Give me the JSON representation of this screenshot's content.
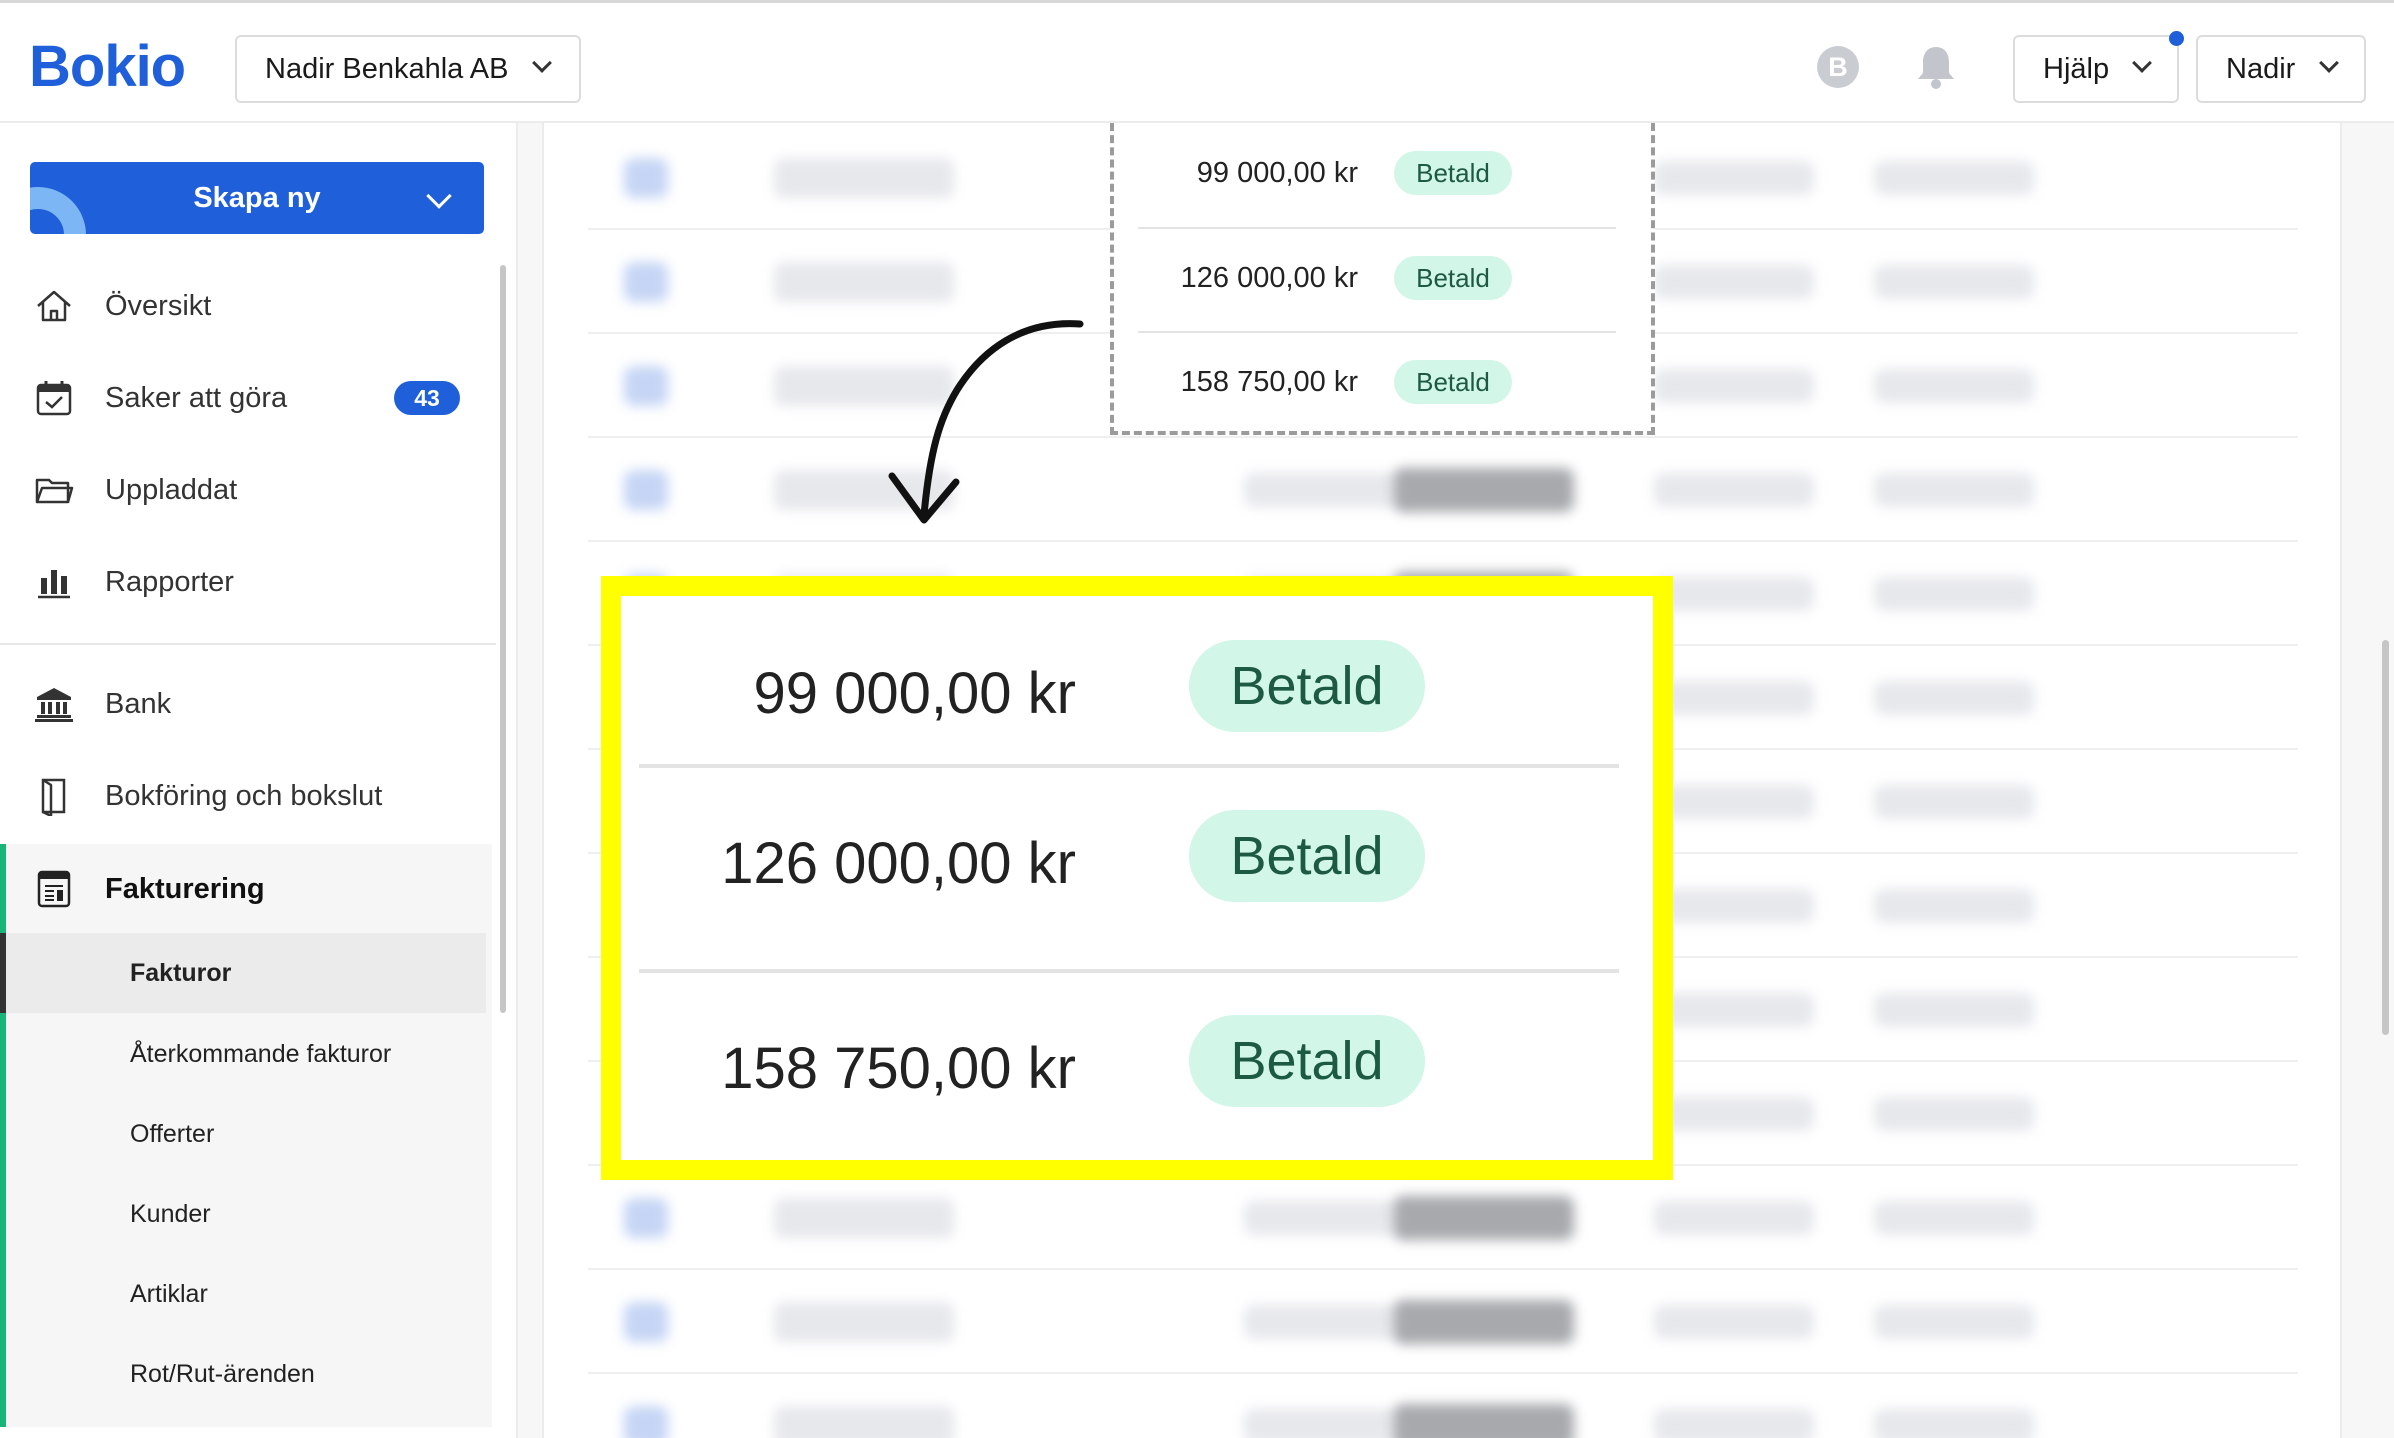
{
  "header": {
    "logo": "Bokio",
    "company": "Nadir Benkahla AB",
    "help_label": "Hjälp",
    "user_label": "Nadir",
    "coin_glyph": "B"
  },
  "sidebar": {
    "create_label": "Skapa ny",
    "items": [
      {
        "label": "Översikt",
        "icon": "home-icon"
      },
      {
        "label": "Saker att göra",
        "icon": "calendar-check-icon",
        "badge": "43"
      },
      {
        "label": "Uppladdat",
        "icon": "folder-icon"
      },
      {
        "label": "Rapporter",
        "icon": "bar-chart-icon"
      },
      {
        "label": "Bank",
        "icon": "bank-icon"
      },
      {
        "label": "Bokföring och bokslut",
        "icon": "book-icon"
      },
      {
        "label": "Fakturering",
        "icon": "invoice-icon"
      }
    ],
    "sub_items": [
      {
        "label": "Fakturor"
      },
      {
        "label": "Återkommande fakturor"
      },
      {
        "label": "Offerter"
      },
      {
        "label": "Kunder"
      },
      {
        "label": "Artiklar"
      },
      {
        "label": "Rot/Rut-ärenden"
      }
    ]
  },
  "invoices": [
    {
      "amount": "99 000,00 kr",
      "status": "Betald"
    },
    {
      "amount": "126 000,00 kr",
      "status": "Betald"
    },
    {
      "amount": "158 750,00 kr",
      "status": "Betald"
    }
  ],
  "colors": {
    "brand_blue": "#1f5fd9",
    "active_green": "#19b578",
    "paid_pill_bg": "#d2f6e7",
    "highlight_yellow": "#ffff00"
  }
}
